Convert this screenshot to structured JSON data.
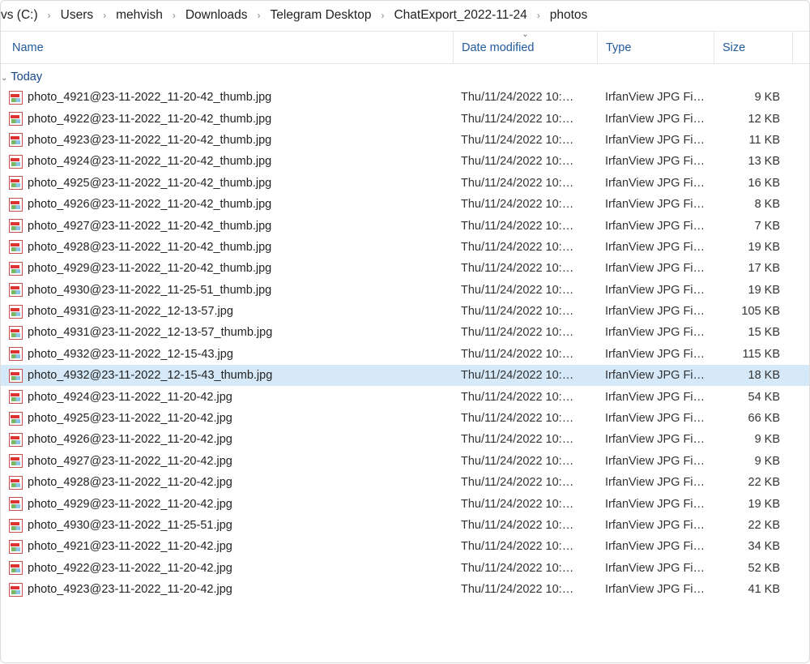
{
  "breadcrumb": [
    "vs (C:)",
    "Users",
    "mehvish",
    "Downloads",
    "Telegram Desktop",
    "ChatExport_2022-11-24",
    "photos"
  ],
  "columns": {
    "name": "Name",
    "date": "Date modified",
    "type": "Type",
    "size": "Size"
  },
  "group": "Today",
  "files": [
    {
      "name": "photo_4921@23-11-2022_11-20-42_thumb.jpg",
      "date": "Thu/11/24/2022 10:…",
      "type": "IrfanView JPG Fi…",
      "size": "9 KB",
      "sel": false
    },
    {
      "name": "photo_4922@23-11-2022_11-20-42_thumb.jpg",
      "date": "Thu/11/24/2022 10:…",
      "type": "IrfanView JPG Fi…",
      "size": "12 KB",
      "sel": false
    },
    {
      "name": "photo_4923@23-11-2022_11-20-42_thumb.jpg",
      "date": "Thu/11/24/2022 10:…",
      "type": "IrfanView JPG Fi…",
      "size": "11 KB",
      "sel": false
    },
    {
      "name": "photo_4924@23-11-2022_11-20-42_thumb.jpg",
      "date": "Thu/11/24/2022 10:…",
      "type": "IrfanView JPG Fi…",
      "size": "13 KB",
      "sel": false
    },
    {
      "name": "photo_4925@23-11-2022_11-20-42_thumb.jpg",
      "date": "Thu/11/24/2022 10:…",
      "type": "IrfanView JPG Fi…",
      "size": "16 KB",
      "sel": false
    },
    {
      "name": "photo_4926@23-11-2022_11-20-42_thumb.jpg",
      "date": "Thu/11/24/2022 10:…",
      "type": "IrfanView JPG Fi…",
      "size": "8 KB",
      "sel": false
    },
    {
      "name": "photo_4927@23-11-2022_11-20-42_thumb.jpg",
      "date": "Thu/11/24/2022 10:…",
      "type": "IrfanView JPG Fi…",
      "size": "7 KB",
      "sel": false
    },
    {
      "name": "photo_4928@23-11-2022_11-20-42_thumb.jpg",
      "date": "Thu/11/24/2022 10:…",
      "type": "IrfanView JPG Fi…",
      "size": "19 KB",
      "sel": false
    },
    {
      "name": "photo_4929@23-11-2022_11-20-42_thumb.jpg",
      "date": "Thu/11/24/2022 10:…",
      "type": "IrfanView JPG Fi…",
      "size": "17 KB",
      "sel": false
    },
    {
      "name": "photo_4930@23-11-2022_11-25-51_thumb.jpg",
      "date": "Thu/11/24/2022 10:…",
      "type": "IrfanView JPG Fi…",
      "size": "19 KB",
      "sel": false
    },
    {
      "name": "photo_4931@23-11-2022_12-13-57.jpg",
      "date": "Thu/11/24/2022 10:…",
      "type": "IrfanView JPG Fi…",
      "size": "105 KB",
      "sel": false
    },
    {
      "name": "photo_4931@23-11-2022_12-13-57_thumb.jpg",
      "date": "Thu/11/24/2022 10:…",
      "type": "IrfanView JPG Fi…",
      "size": "15 KB",
      "sel": false
    },
    {
      "name": "photo_4932@23-11-2022_12-15-43.jpg",
      "date": "Thu/11/24/2022 10:…",
      "type": "IrfanView JPG Fi…",
      "size": "115 KB",
      "sel": false
    },
    {
      "name": "photo_4932@23-11-2022_12-15-43_thumb.jpg",
      "date": "Thu/11/24/2022 10:…",
      "type": "IrfanView JPG Fi…",
      "size": "18 KB",
      "sel": true
    },
    {
      "name": "photo_4924@23-11-2022_11-20-42.jpg",
      "date": "Thu/11/24/2022 10:…",
      "type": "IrfanView JPG Fi…",
      "size": "54 KB",
      "sel": false
    },
    {
      "name": "photo_4925@23-11-2022_11-20-42.jpg",
      "date": "Thu/11/24/2022 10:…",
      "type": "IrfanView JPG Fi…",
      "size": "66 KB",
      "sel": false
    },
    {
      "name": "photo_4926@23-11-2022_11-20-42.jpg",
      "date": "Thu/11/24/2022 10:…",
      "type": "IrfanView JPG Fi…",
      "size": "9 KB",
      "sel": false
    },
    {
      "name": "photo_4927@23-11-2022_11-20-42.jpg",
      "date": "Thu/11/24/2022 10:…",
      "type": "IrfanView JPG Fi…",
      "size": "9 KB",
      "sel": false
    },
    {
      "name": "photo_4928@23-11-2022_11-20-42.jpg",
      "date": "Thu/11/24/2022 10:…",
      "type": "IrfanView JPG Fi…",
      "size": "22 KB",
      "sel": false
    },
    {
      "name": "photo_4929@23-11-2022_11-20-42.jpg",
      "date": "Thu/11/24/2022 10:…",
      "type": "IrfanView JPG Fi…",
      "size": "19 KB",
      "sel": false
    },
    {
      "name": "photo_4930@23-11-2022_11-25-51.jpg",
      "date": "Thu/11/24/2022 10:…",
      "type": "IrfanView JPG Fi…",
      "size": "22 KB",
      "sel": false
    },
    {
      "name": "photo_4921@23-11-2022_11-20-42.jpg",
      "date": "Thu/11/24/2022 10:…",
      "type": "IrfanView JPG Fi…",
      "size": "34 KB",
      "sel": false
    },
    {
      "name": "photo_4922@23-11-2022_11-20-42.jpg",
      "date": "Thu/11/24/2022 10:…",
      "type": "IrfanView JPG Fi…",
      "size": "52 KB",
      "sel": false
    },
    {
      "name": "photo_4923@23-11-2022_11-20-42.jpg",
      "date": "Thu/11/24/2022 10:…",
      "type": "IrfanView JPG Fi…",
      "size": "41 KB",
      "sel": false
    }
  ]
}
